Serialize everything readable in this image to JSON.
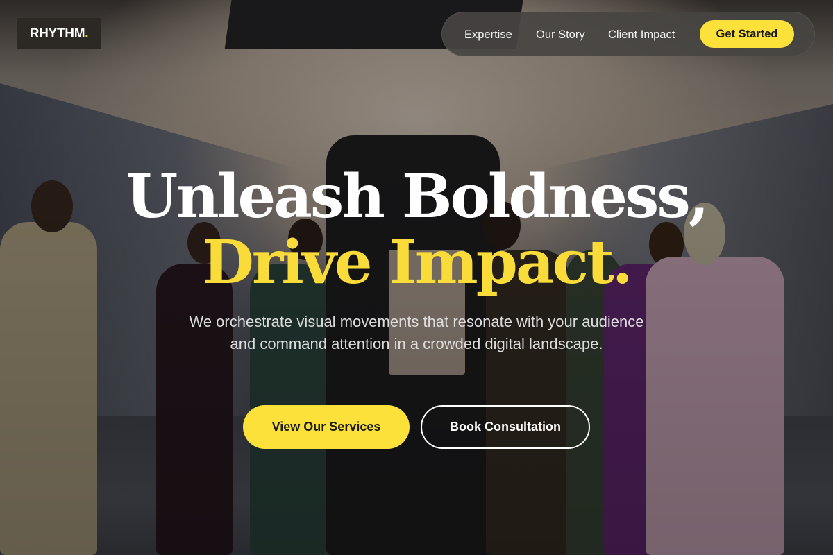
{
  "brand": {
    "name": "RHYTHM",
    "dot": "."
  },
  "nav": {
    "links": [
      "Expertise",
      "Our Story",
      "Client Impact"
    ],
    "cta": "Get Started"
  },
  "hero": {
    "headline_line1": "Unleash Boldness,",
    "headline_line2": "Drive Impact.",
    "subtitle": "We orchestrate visual movements that resonate with your audience and command attention in a crowded digital landscape.",
    "primary_button": "View Our Services",
    "secondary_button": "Book Consultation",
    "background_image": "photo-people-fashion-gathering"
  },
  "colors": {
    "accent": "#fbe13a",
    "headline_white": "#ffffff",
    "nav_bg": "#464442",
    "logo_bg": "#2c2925"
  }
}
